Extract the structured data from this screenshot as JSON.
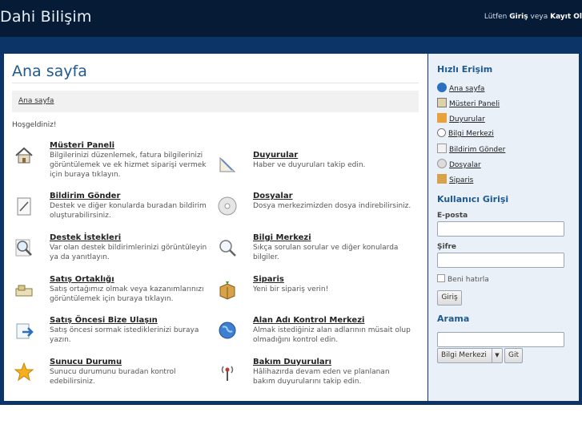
{
  "header": {
    "brand": "Dahi Bilişim",
    "login_prefix": "Lütfen",
    "login_link": "Giriş",
    "login_mid": "veya",
    "register_link": "Kayıt Ol"
  },
  "main": {
    "title": "Ana sayfa",
    "breadcrumb": "Ana sayfa",
    "welcome": "Hoşgeldiniz!",
    "items": [
      {
        "title": "Müsteri Paneli",
        "desc": "Bilgilerinizi düzenlemek, fatura bilgilerinizi görüntülemek ve ek hizmet siparişi vermek için buraya tıklayın.",
        "icon": "home-icon"
      },
      {
        "title": "Duyurular",
        "desc": "Haber ve duyuruları takip edin.",
        "icon": "announcement-icon"
      },
      {
        "title": "Bildirim Gönder",
        "desc": "Destek ve diğer konularda buradan bildirim oluşturabilirsiniz.",
        "icon": "ticket-icon"
      },
      {
        "title": "Dosyalar",
        "desc": "Dosya merkezimizden dosya indirebilirsiniz.",
        "icon": "disc-icon"
      },
      {
        "title": "Destek İstekleri",
        "desc": "Var olan destek bildirimlerinizi görüntüleyin ya da yanıtlayın.",
        "icon": "magnifier-icon"
      },
      {
        "title": "Bilgi Merkezi",
        "desc": "Sıkça sorulan sorular ve diğer konularda bilgiler.",
        "icon": "search-icon"
      },
      {
        "title": "Satış Ortaklığı",
        "desc": "Satış ortağımız olmak veya kazanımlarınızı görüntülemek için buraya tıklayın.",
        "icon": "money-icon"
      },
      {
        "title": "Siparis",
        "desc": "Yeni bir sipariş verin!",
        "icon": "package-icon"
      },
      {
        "title": "Satış Öncesi Bize Ulaşın",
        "desc": "Satış öncesi sormak istediklerinizi buraya yazın.",
        "icon": "forward-icon"
      },
      {
        "title": "Alan Adı Kontrol Merkezi",
        "desc": "Almak istediğiniz alan adlarının müsait olup olmadığını kontrol edin.",
        "icon": "globe-icon"
      },
      {
        "title": "Sunucu Durumu",
        "desc": "Sunucu durumunu buradan kontrol edebilirsiniz.",
        "icon": "star-icon"
      },
      {
        "title": "Bakım Duyuruları",
        "desc": "Hâlihazırda devam eden ve planlanan bakım duyurularını takip edin.",
        "icon": "antenna-icon"
      }
    ]
  },
  "sidebar": {
    "quick_title": "Hızlı Erişim",
    "quick_links": [
      {
        "label": "Ana sayfa",
        "icon": "home-globe-icon"
      },
      {
        "label": "Müsteri Paneli",
        "icon": "house-icon"
      },
      {
        "label": "Duyurular",
        "icon": "folder-icon"
      },
      {
        "label": "Bilgi Merkezi",
        "icon": "magnifier-icon"
      },
      {
        "label": "Bildirim Gönder",
        "icon": "note-icon"
      },
      {
        "label": "Dosyalar",
        "icon": "disc-icon"
      },
      {
        "label": "Siparis",
        "icon": "package-icon"
      }
    ],
    "login_title": "Kullanıcı Girişi",
    "email_label": "E-posta",
    "password_label": "Şifre",
    "remember_label": "Beni hatırla",
    "login_button": "Giriş",
    "search_title": "Arama",
    "search_select": "Bilgi Merkezi",
    "search_button": "Git"
  },
  "colors": {
    "header_bg": "#061b36",
    "accent": "#1f5a8f",
    "frame": "#0c3466",
    "sidebar_bg": "#eaf0f8"
  }
}
